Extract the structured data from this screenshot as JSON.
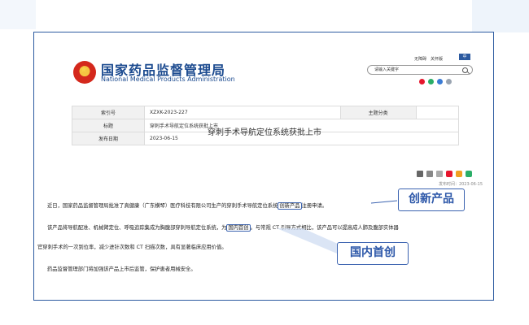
{
  "header": {
    "name_cn": "国家药品监督管理局",
    "name_en": "National Medical Products Administration",
    "top_links": [
      "无障碍",
      "关怀版"
    ],
    "lang": "中",
    "search_placeholder": "请输入关键字"
  },
  "table": {
    "rows": [
      {
        "label": "索引号",
        "value": "XZXK-2023-227",
        "label2": "主题分类",
        "value2": ""
      },
      {
        "label": "标题",
        "value": "穿刺手术导航定位系统获批上市"
      },
      {
        "label": "发布日期",
        "value": "2023-06-15"
      }
    ]
  },
  "article": {
    "title": "穿刺手术导航定位系统获批上市",
    "date": "发布时间：2023-06-15",
    "p1_a": "近日，国家药品监督管理局批准了真健康（广东横琴）医疗科技有限公司生产的穿刺手术导航定位系统",
    "p1_hl": "创新产品",
    "p1_b": "注册申请。",
    "p2_a": "该产品将导航配准、机械臂定位、呼吸追踪集成为胸腹部穿刺导航定位系统，为",
    "p2_hl": "国内首创",
    "p2_b": "。与常规 CT 引导方式相比，该产品可以提高成人肺及腹部实体器",
    "p3": "官穿刺手术的一次到位率，减少进针次数和 CT 扫描次数，具有显著临床应用价值。",
    "p4": "药品监督管理部门将加强该产品上市后监管，保护患者用械安全。"
  },
  "callouts": {
    "c1": "创新产品",
    "c2": "国内首创"
  },
  "colors": {
    "brand": "#1b4a8f",
    "accent": "#3b63b0"
  }
}
